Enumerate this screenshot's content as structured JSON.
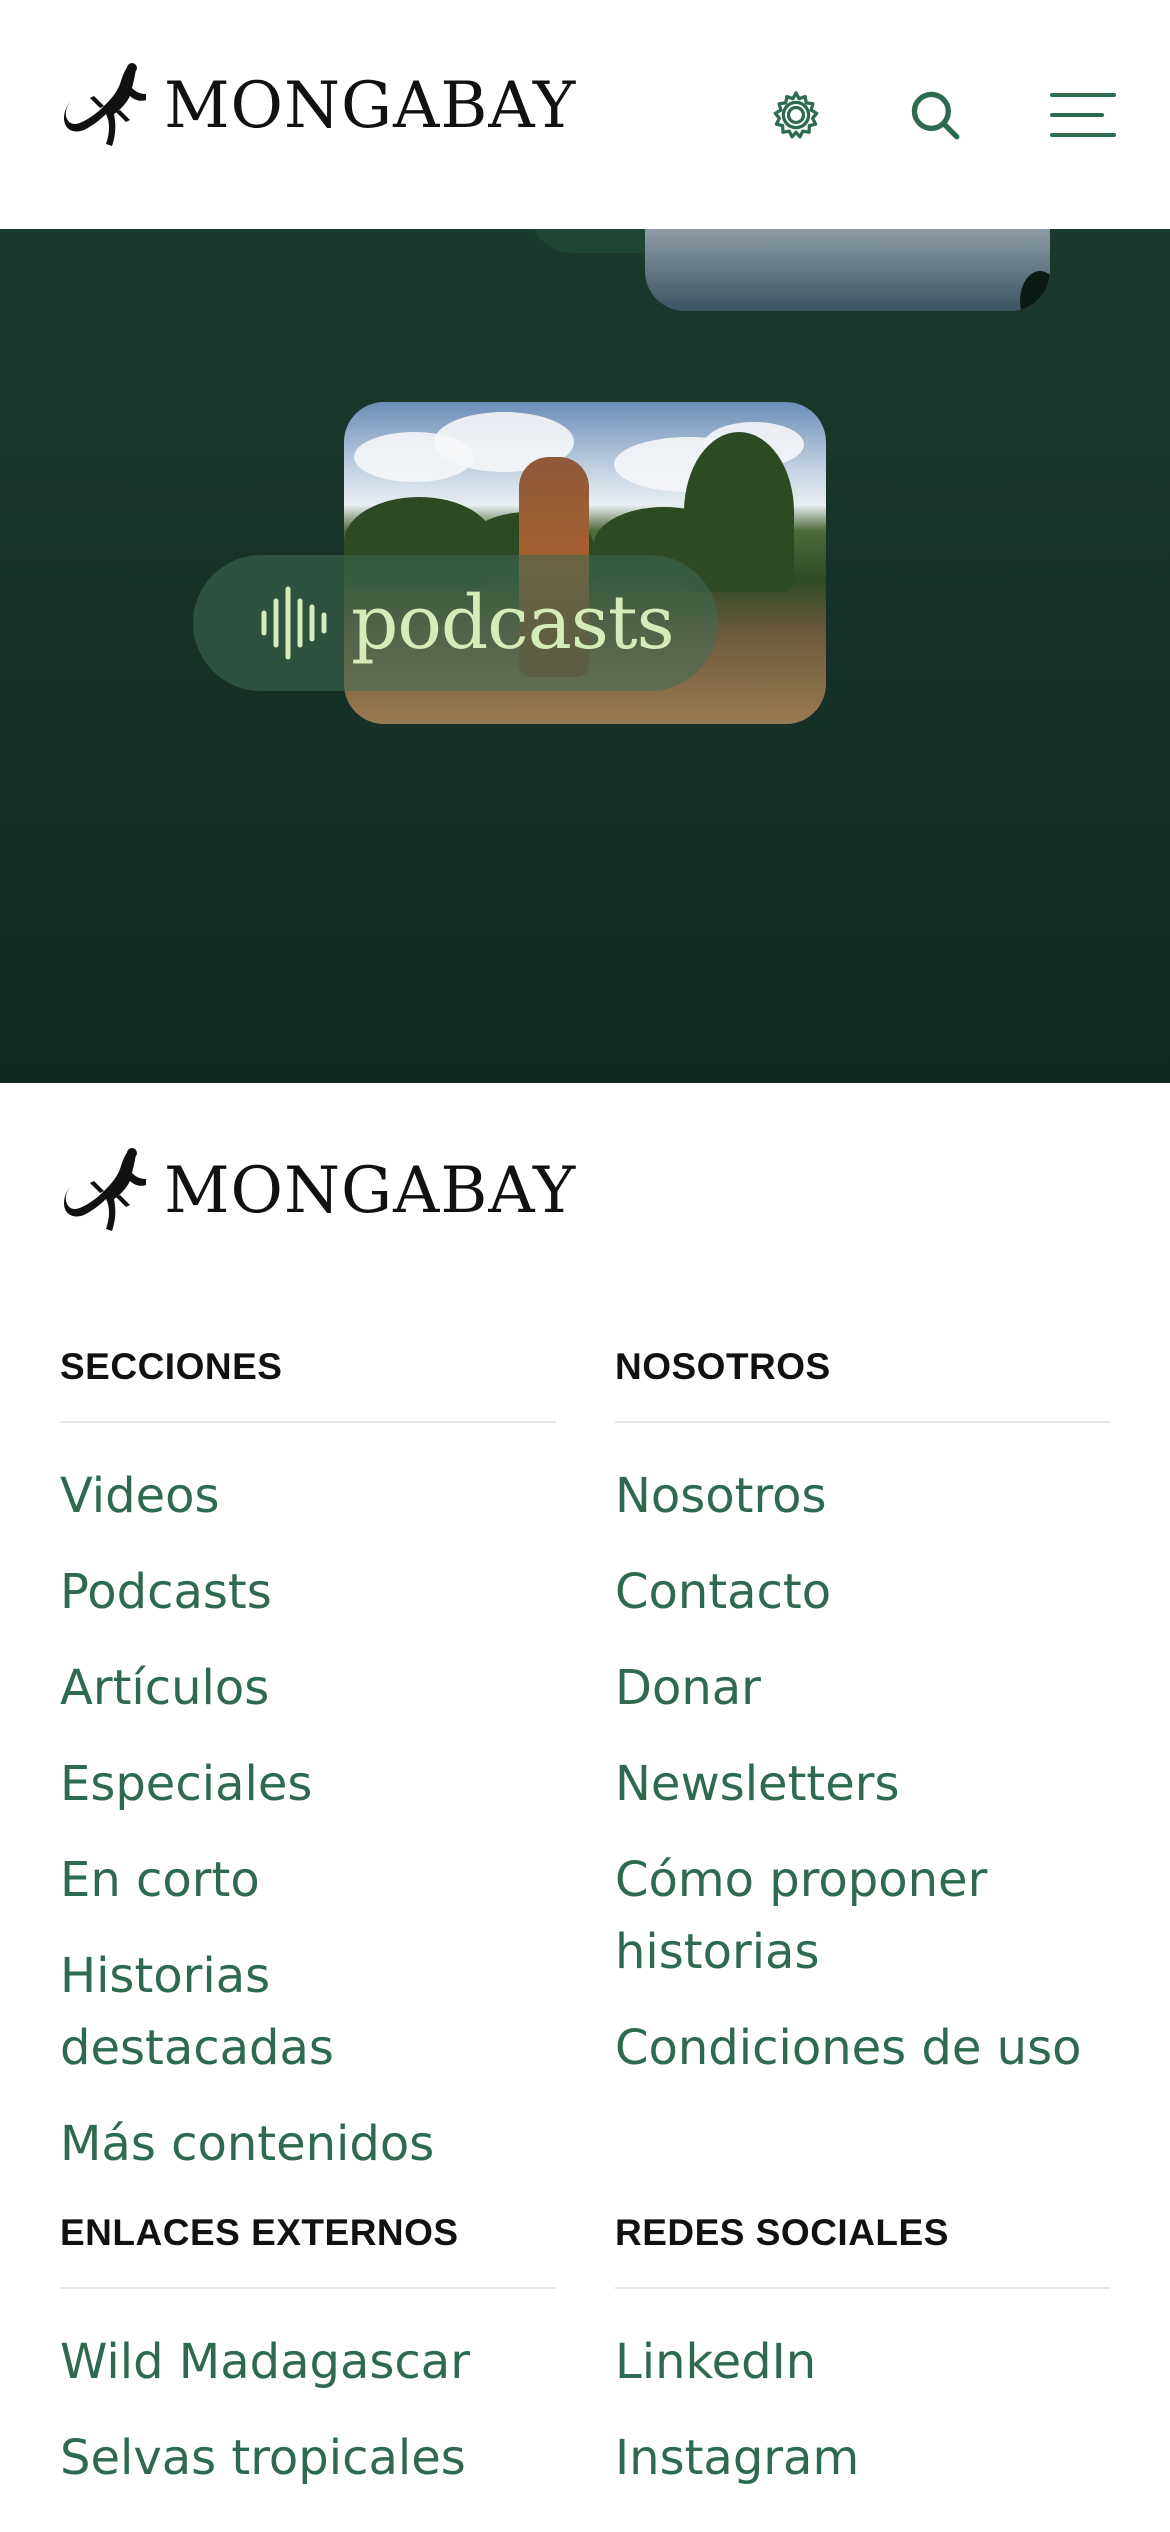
{
  "header": {
    "logo_text": "MONGABAY",
    "settings_icon": "gear-icon",
    "search_icon": "search-icon",
    "menu_icon": "hamburger-menu-icon"
  },
  "hero": {
    "pill_label": "podcasts",
    "pill_icon": "audio-waveform-icon"
  },
  "footer": {
    "logo_text": "MONGABAY",
    "sections": [
      {
        "title": "SECCIONES",
        "links": [
          "Videos",
          "Podcasts",
          "Artículos",
          "Especiales",
          "En corto",
          "Historias destacadas",
          "Más contenidos"
        ]
      },
      {
        "title": "NOSOTROS",
        "links": [
          "Nosotros",
          "Contacto",
          "Donar",
          "Newsletters",
          "Cómo proponer historias",
          "Condiciones de uso"
        ]
      },
      {
        "title": "ENLACES EXTERNOS",
        "links": [
          "Wild Madagascar",
          "Selvas tropicales"
        ]
      },
      {
        "title": "REDES SOCIALES",
        "links": [
          "LinkedIn",
          "Instagram"
        ]
      }
    ]
  },
  "colors": {
    "accent_green": "#2d6a4f",
    "hero_dark": "#163227",
    "pill_text": "#d6ecb8"
  }
}
